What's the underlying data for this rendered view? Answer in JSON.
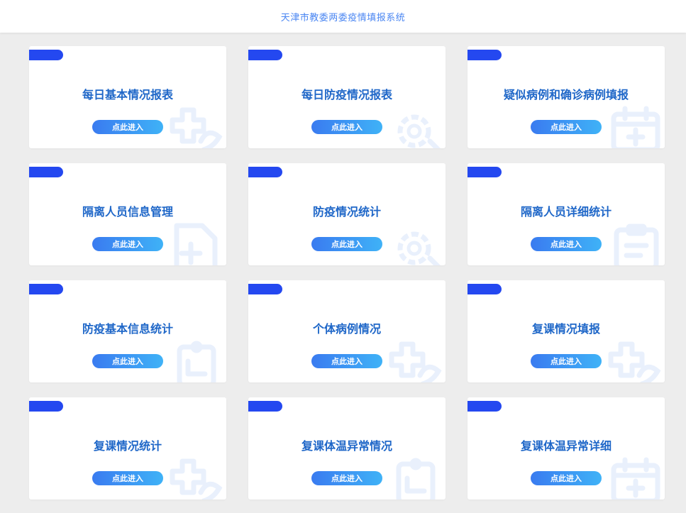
{
  "header": {
    "title": "天津市教委两委疫情填报系统"
  },
  "cards": [
    {
      "title": "每日基本情况报表",
      "button": "点此进入",
      "icon": "medical-cross-icon"
    },
    {
      "title": "每日防疫情况报表",
      "button": "点此进入",
      "icon": "gear-icon"
    },
    {
      "title": "疑似病例和确诊病例填报",
      "button": "点此进入",
      "icon": "calendar-icon"
    },
    {
      "title": "隔离人员信息管理",
      "button": "点此进入",
      "icon": "document-plus-icon"
    },
    {
      "title": "防疫情况统计",
      "button": "点此进入",
      "icon": "gear-icon"
    },
    {
      "title": "隔离人员详细统计",
      "button": "点此进入",
      "icon": "clipboard-icon"
    },
    {
      "title": "防疫基本信息统计",
      "button": "点此进入",
      "icon": "clipboard-report-icon"
    },
    {
      "title": "个体病例情况",
      "button": "点此进入",
      "icon": "medical-cross-icon"
    },
    {
      "title": "复课情况填报",
      "button": "点此进入",
      "icon": "medical-cross-icon"
    },
    {
      "title": "复课情况统计",
      "button": "点此进入",
      "icon": "medical-cross-icon"
    },
    {
      "title": "复课体温异常情况",
      "button": "点此进入",
      "icon": "clipboard-report-icon"
    },
    {
      "title": "复课体温异常详细",
      "button": "点此进入",
      "icon": "calendar-icon"
    }
  ],
  "colors": {
    "tab": "#2448f0",
    "title": "#1f67c8",
    "button_start": "#3a7bf0",
    "button_end": "#3fb2f7",
    "icon": "#e9f0fc"
  }
}
